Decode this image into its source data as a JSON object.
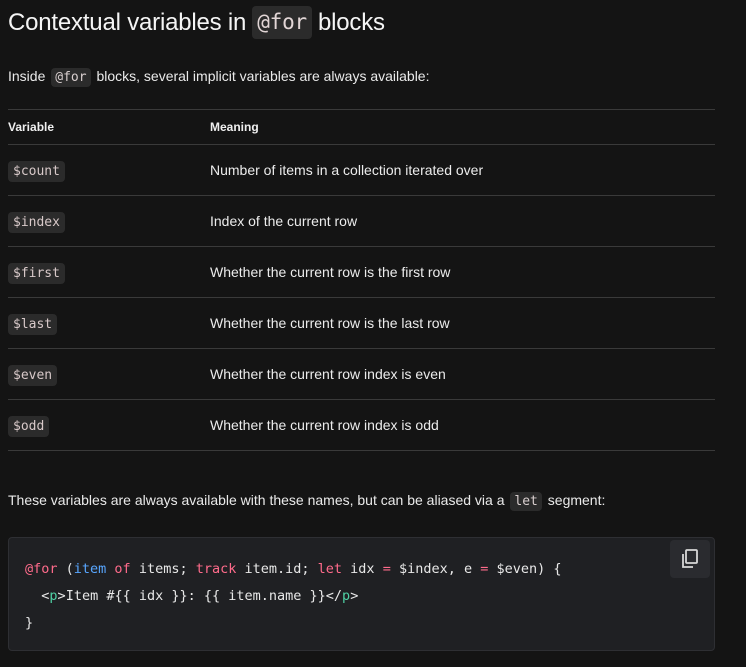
{
  "heading": {
    "before": "Contextual variables in",
    "code": "@for",
    "after": "blocks"
  },
  "intro": {
    "before": "Inside",
    "code": "@for",
    "after": "blocks, several implicit variables are always available:"
  },
  "table": {
    "headers": [
      "Variable",
      "Meaning"
    ],
    "rows": [
      {
        "variable": "$count",
        "meaning": "Number of items in a collection iterated over"
      },
      {
        "variable": "$index",
        "meaning": "Index of the current row"
      },
      {
        "variable": "$first",
        "meaning": "Whether the current row is the first row"
      },
      {
        "variable": "$last",
        "meaning": "Whether the current row is the last row"
      },
      {
        "variable": "$even",
        "meaning": "Whether the current row index is even"
      },
      {
        "variable": "$odd",
        "meaning": "Whether the current row index is odd"
      }
    ]
  },
  "alias_note": {
    "before": "These variables are always available with these names, but can be aliased via a",
    "code": "let",
    "after": "segment:"
  },
  "code_example": {
    "line1": {
      "kw_for": "@for",
      "open": " (",
      "var_item": "item",
      "kw_of": " of",
      "items": " items;",
      "kw_track": " track",
      "track_expr": " item.id;",
      "kw_let": " let",
      "idx": " idx",
      "eq1": " =",
      "index": " $index,",
      "e": " e",
      "eq2": " =",
      "even": " $even)",
      "brace": " {"
    },
    "line2": {
      "indent": "  ",
      "lt1": "<",
      "tag_p1": "p",
      "gt1": ">",
      "text": "Item #{{ idx }}: {{ item.name }}",
      "lt2": "</",
      "tag_p2": "p",
      "gt2": ">"
    },
    "line3": "}",
    "copy_icon": "copy-icon"
  },
  "colors": {
    "background": "#141414",
    "code_background": "#1f2023",
    "keyword": "#ff6b8b",
    "variable": "#58a6ff",
    "tag": "#4fd1a5"
  }
}
